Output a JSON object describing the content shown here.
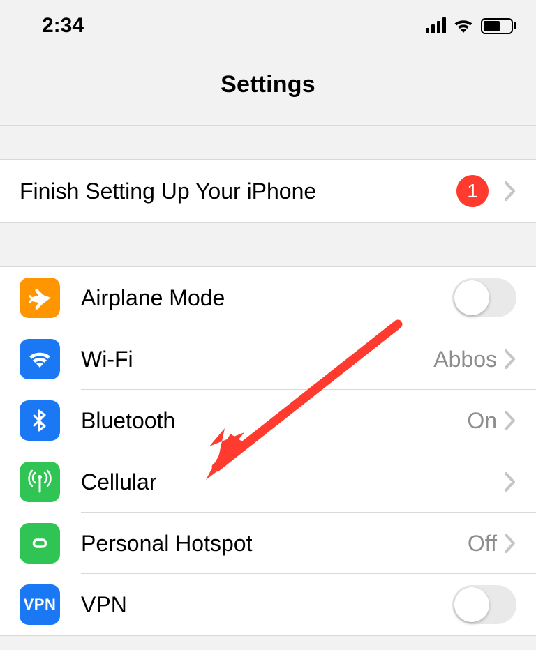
{
  "status_bar": {
    "time": "2:34"
  },
  "header": {
    "title": "Settings"
  },
  "setup": {
    "label": "Finish Setting Up Your iPhone",
    "badge": "1"
  },
  "rows": {
    "airplane": {
      "label": "Airplane Mode"
    },
    "wifi": {
      "label": "Wi-Fi",
      "value": "Abbos"
    },
    "bluetooth": {
      "label": "Bluetooth",
      "value": "On"
    },
    "cellular": {
      "label": "Cellular"
    },
    "hotspot": {
      "label": "Personal Hotspot",
      "value": "Off"
    },
    "vpn": {
      "label": "VPN",
      "icon_text": "VPN"
    }
  }
}
